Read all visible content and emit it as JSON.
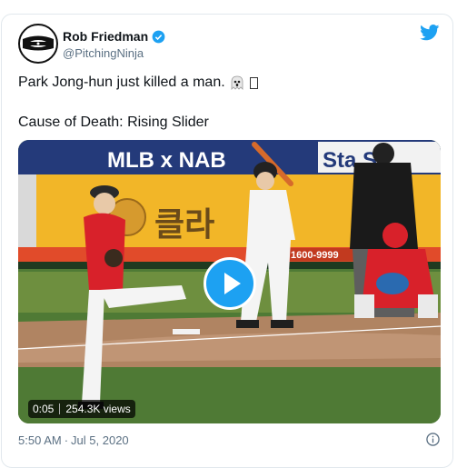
{
  "tweet": {
    "author": {
      "display_name": "Rob Friedman",
      "handle": "@PitchingNinja",
      "verified": true
    },
    "lines": [
      "Park Jong-hun just killed a man.",
      "Cause of Death: Rising Slider"
    ],
    "emoji": "ghost-emoji",
    "video": {
      "scoreboard_text": "MLB x NAB",
      "ad_text": "클라",
      "phone": "1600-9999",
      "duration": "0:05",
      "views": "254.3K views"
    },
    "time": "5:50 AM",
    "separator": "·",
    "date": "Jul 5, 2020"
  },
  "colors": {
    "accent": "#1da1f2",
    "text": "#0f1419",
    "muted": "#5b7083"
  }
}
